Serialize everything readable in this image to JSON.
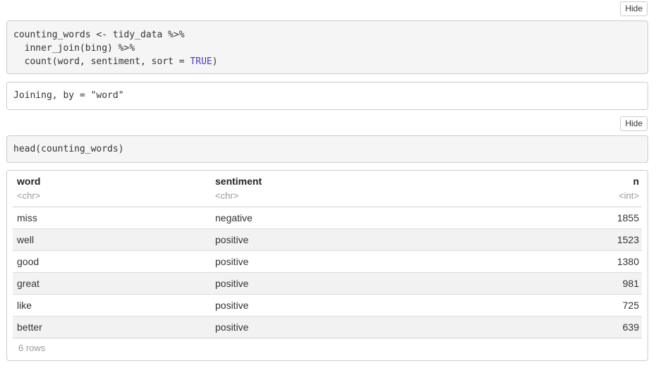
{
  "chunk1": {
    "hide_label": "Hide",
    "code_lines": [
      "counting_words <- tidy_data %>%",
      "  inner_join(bing) %>%",
      "  count(word, sentiment, sort = ",
      "TRUE",
      ")"
    ],
    "output": "Joining, by = \"word\""
  },
  "chunk2": {
    "hide_label": "Hide",
    "code": "head(counting_words)"
  },
  "table": {
    "columns": [
      {
        "name": "word",
        "type": "<chr>"
      },
      {
        "name": "sentiment",
        "type": "<chr>"
      },
      {
        "name": "n",
        "type": "<int>"
      }
    ],
    "rows": [
      {
        "word": "miss",
        "sentiment": "negative",
        "n": "1855"
      },
      {
        "word": "well",
        "sentiment": "positive",
        "n": "1523"
      },
      {
        "word": "good",
        "sentiment": "positive",
        "n": "1380"
      },
      {
        "word": "great",
        "sentiment": "positive",
        "n": "981"
      },
      {
        "word": "like",
        "sentiment": "positive",
        "n": "725"
      },
      {
        "word": "better",
        "sentiment": "positive",
        "n": "639"
      }
    ],
    "footer": "6 rows"
  },
  "colors": {
    "keyword_true": "#4f3bbf",
    "code_bg": "#f5f5f5",
    "border": "#cccccc",
    "stripe": "#f2f2f2",
    "muted": "#999999"
  }
}
